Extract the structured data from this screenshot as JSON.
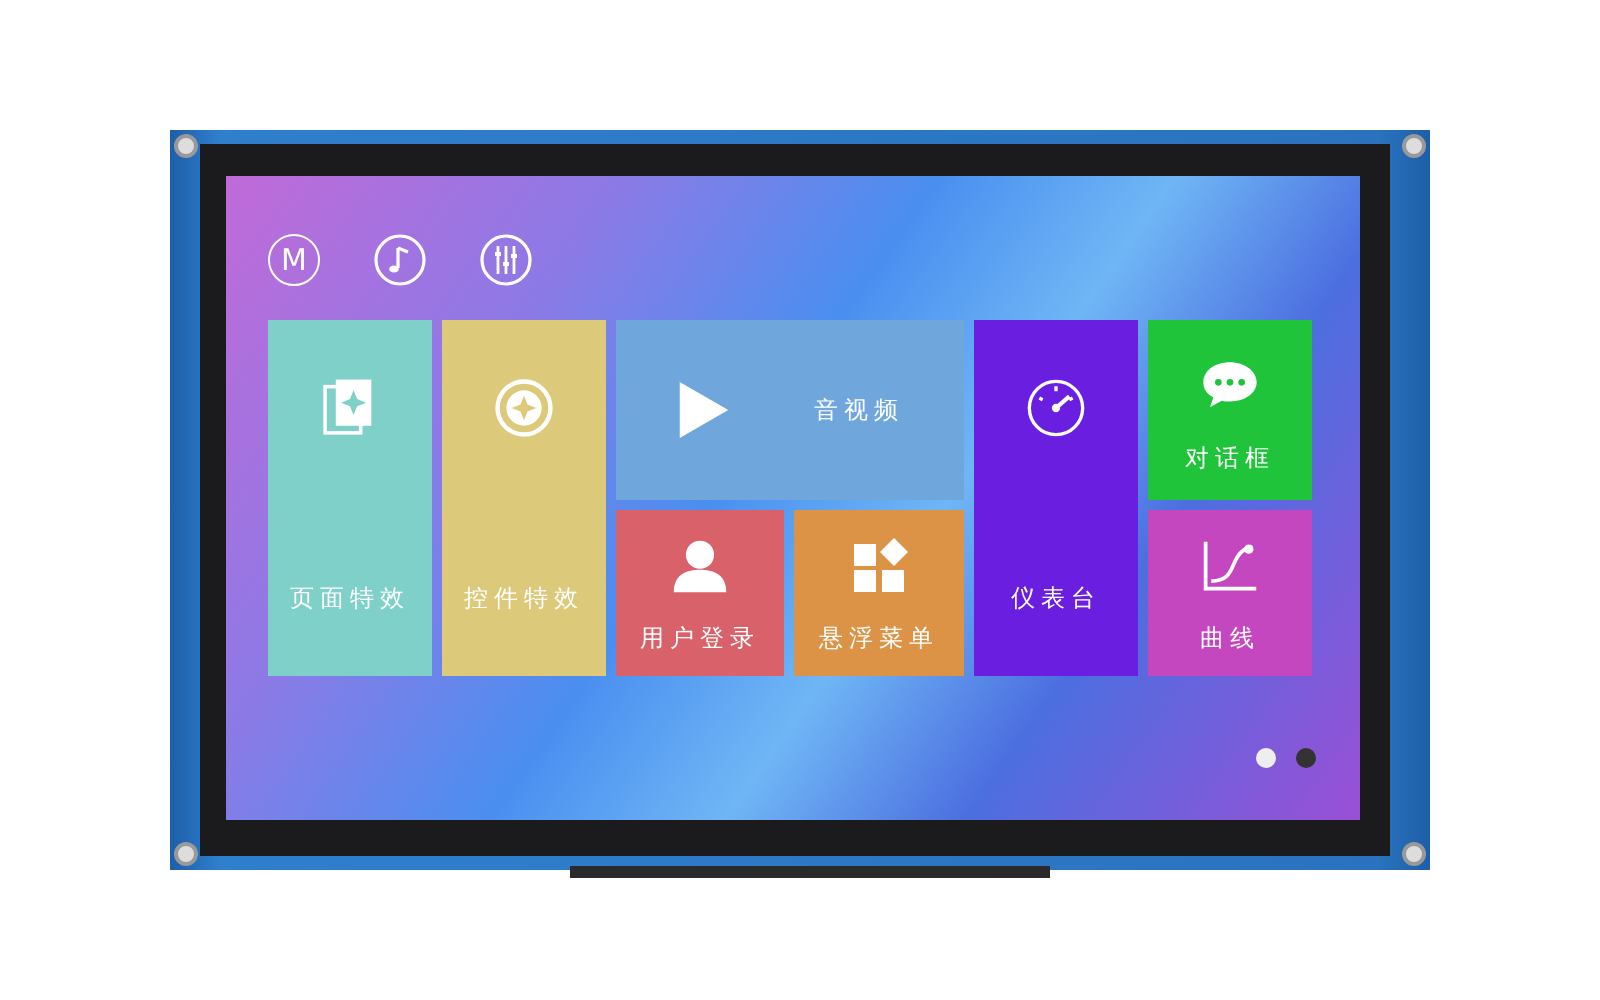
{
  "top_icons": [
    {
      "kind": "letter",
      "text": "M"
    },
    {
      "kind": "music"
    },
    {
      "kind": "mixer"
    }
  ],
  "tiles": [
    {
      "label": "页面特效",
      "kind": "cards",
      "color": "#7fd0c8"
    },
    {
      "label": "控件特效",
      "kind": "compass",
      "color": "#dcc97a"
    },
    {
      "label": "音视频",
      "kind": "play",
      "color": "#6fa6dc"
    },
    {
      "label": "用户登录",
      "kind": "user",
      "color": "#d9616a"
    },
    {
      "label": "悬浮菜单",
      "kind": "widgets",
      "color": "#dc9346"
    },
    {
      "label": "仪表台",
      "kind": "gauge",
      "color": "#6a1fe0"
    },
    {
      "label": "对话框",
      "kind": "chat",
      "color": "#1fc43a"
    },
    {
      "label": "曲线",
      "kind": "curve",
      "color": "#c447c0"
    }
  ],
  "page_dots": [
    {
      "selected": true
    },
    {
      "selected": false
    }
  ]
}
